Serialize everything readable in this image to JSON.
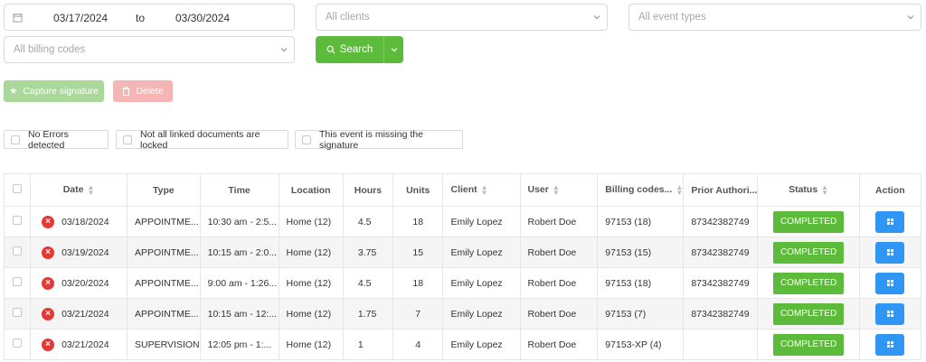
{
  "filters": {
    "date_from": "03/17/2024",
    "date_to_label": "to",
    "date_to": "03/30/2024",
    "clients_placeholder": "All clients",
    "event_types_placeholder": "All event types",
    "billing_codes_placeholder": "All billing codes",
    "search_label": "Search"
  },
  "actions": {
    "capture_label": "Capture signature",
    "delete_label": "Delete"
  },
  "chips": {
    "no_errors": "No Errors detected",
    "not_locked": "Not all linked documents are locked",
    "missing_signature": "This event is missing the signature"
  },
  "table": {
    "headers": {
      "date": "Date",
      "type": "Type",
      "time": "Time",
      "location": "Location",
      "hours": "Hours",
      "units": "Units",
      "client": "Client",
      "user": "User",
      "billing": "Billing codes...",
      "prior": "Prior Authori...",
      "status": "Status",
      "action": "Action"
    },
    "rows": [
      {
        "date": "03/18/2024",
        "type": "APPOINTME...",
        "time": "10:30 am - 2:5...",
        "location": "Home (12)",
        "hours": "4.5",
        "units": "18",
        "client": "Emily Lopez",
        "user": "Robert Doe",
        "billing": "97153 (18)",
        "prior": "87342382749",
        "status": "COMPLETED"
      },
      {
        "date": "03/19/2024",
        "type": "APPOINTME...",
        "time": "10:15 am - 2:0...",
        "location": "Home (12)",
        "hours": "3.75",
        "units": "15",
        "client": "Emily Lopez",
        "user": "Robert Doe",
        "billing": "97153 (15)",
        "prior": "87342382749",
        "status": "COMPLETED"
      },
      {
        "date": "03/20/2024",
        "type": "APPOINTME...",
        "time": "9:00 am - 1:26...",
        "location": "Home (12)",
        "hours": "4.5",
        "units": "18",
        "client": "Emily Lopez",
        "user": "Robert Doe",
        "billing": "97153 (18)",
        "prior": "87342382749",
        "status": "COMPLETED"
      },
      {
        "date": "03/21/2024",
        "type": "APPOINTME...",
        "time": "10:15 am - 12:...",
        "location": "Home (12)",
        "hours": "1.75",
        "units": "7",
        "client": "Emily Lopez",
        "user": "Robert Doe",
        "billing": "97153 (7)",
        "prior": "87342382749",
        "status": "COMPLETED"
      },
      {
        "date": "03/21/2024",
        "type": "SUPERVISION",
        "time": "12:05 pm - 1:...",
        "location": "Home (12)",
        "hours": "1",
        "units": "4",
        "client": "Emily Lopez",
        "user": "Robert Doe",
        "billing": "97153-XP (4)",
        "prior": "",
        "status": "COMPLETED"
      }
    ]
  },
  "colors": {
    "primary_green": "#5cbb3a",
    "error_red": "#e53935",
    "action_blue": "#2f96f3"
  },
  "icons": {
    "calendar": "calendar-icon",
    "chevron": "chevron-down-icon",
    "search": "search-icon",
    "star": "star-icon",
    "trash": "trash-icon",
    "error": "error-icon",
    "grid": "grid-icon",
    "sort": "sort-icon"
  }
}
